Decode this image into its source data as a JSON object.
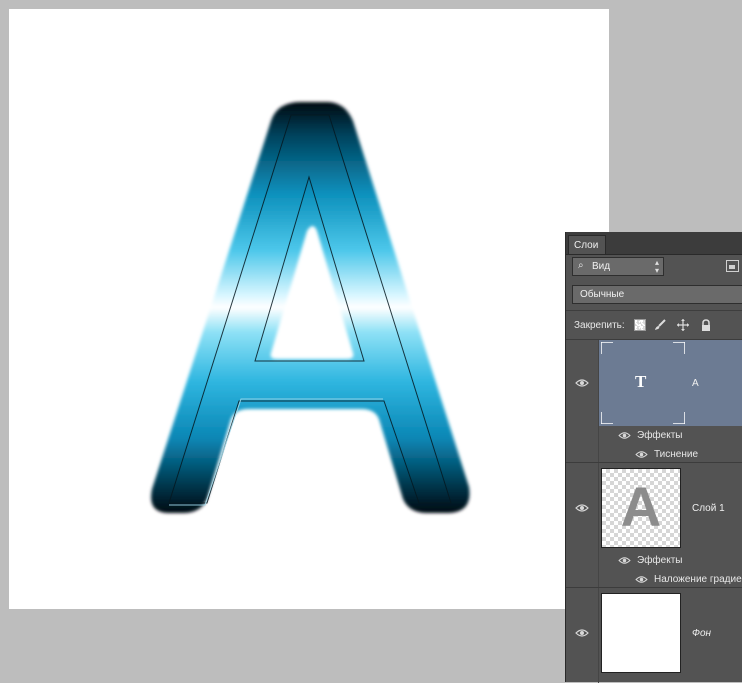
{
  "document": {
    "letter": "A",
    "colors": {
      "canvas": "#ffffff",
      "workspace": "#bdbdbd",
      "gradient_dark": "#01202c",
      "gradient_mid": "#0aa0cc",
      "gradient_light": "#9fe6f8"
    }
  },
  "layers_panel": {
    "tab_label": "Слои",
    "filter_value": "Вид",
    "blend_mode": "Обычные",
    "lock_label": "Закрепить:",
    "layers": [
      {
        "name": "A",
        "thumb_glyph": "T",
        "effects_label": "Эффекты",
        "effects": [
          "Тиснение"
        ]
      },
      {
        "name": "Слой 1",
        "thumb_glyph": "A",
        "effects_label": "Эффекты",
        "effects": [
          "Наложение градиента"
        ]
      },
      {
        "name": "Фон"
      }
    ]
  }
}
